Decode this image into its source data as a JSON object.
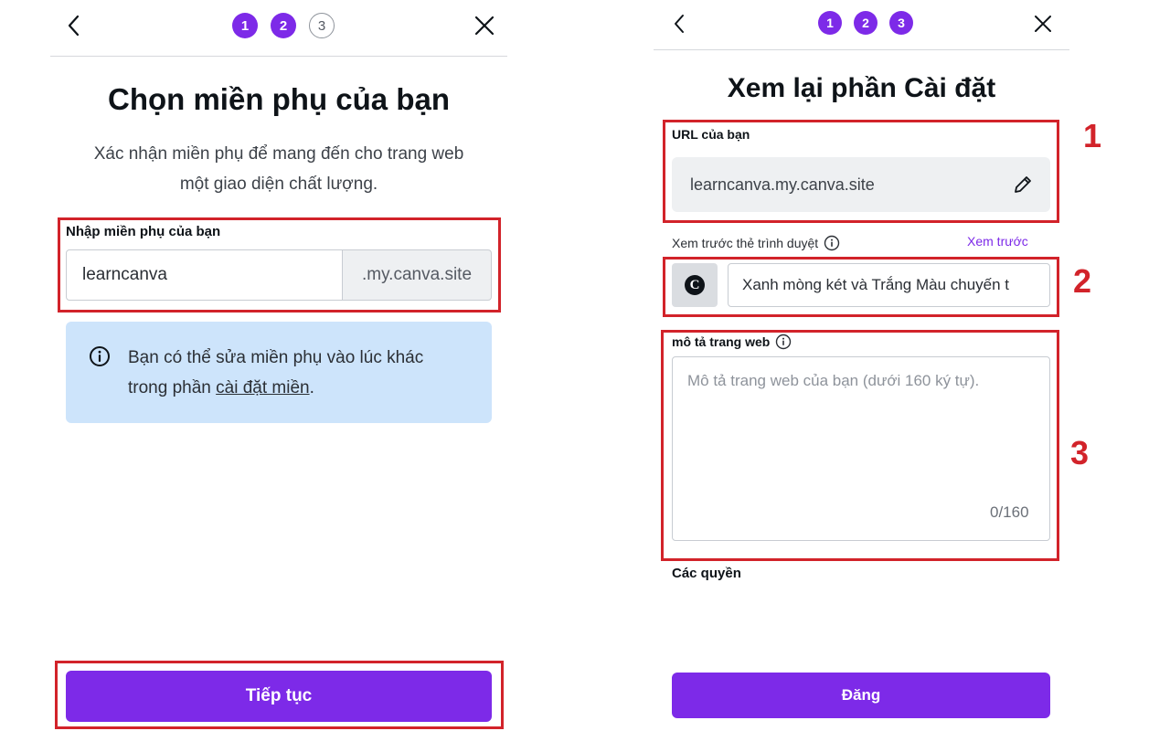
{
  "left": {
    "steps": [
      "1",
      "2",
      "3"
    ],
    "title": "Chọn miền phụ của bạn",
    "subtitle_line1": "Xác nhận miền phụ để mang đến cho trang web",
    "subtitle_line2": "một giao diện chất lượng.",
    "field_label": "Nhập miền phụ của bạn",
    "subdomain_value": "learncanva",
    "domain_suffix": ".my.canva.site",
    "info_line1": "Bạn có thể sửa miền phụ vào lúc khác",
    "info_line2_prefix": "trong phần ",
    "info_link": "cài đặt miền",
    "info_line2_suffix": ".",
    "continue_label": "Tiếp tục"
  },
  "right": {
    "steps": [
      "1",
      "2",
      "3"
    ],
    "title": "Xem lại phần Cài đặt",
    "url_label": "URL của bạn",
    "url_value": "learncanva.my.canva.site",
    "browser_preview_label": "Xem trước thẻ trình duyệt",
    "preview_link": "Xem trước",
    "favicon_letter": "C",
    "tab_title_value": "Xanh mòng két và Trắng Màu chuyến t",
    "description_label": "mô tả trang web",
    "description_placeholder": "Mô tả trang web của bạn (dưới 160 ký tự).",
    "char_counter": "0/160",
    "permissions_label": "Các quyền",
    "publish_label": "Đăng"
  },
  "annotations": {
    "numbers": [
      "1",
      "2",
      "3"
    ],
    "color": "#d2232a"
  },
  "colors": {
    "accent": "#7d2ae8",
    "info_bg": "#cde4fb"
  },
  "icons": [
    "back-arrow-icon",
    "close-icon",
    "info-icon",
    "pencil-icon"
  ]
}
